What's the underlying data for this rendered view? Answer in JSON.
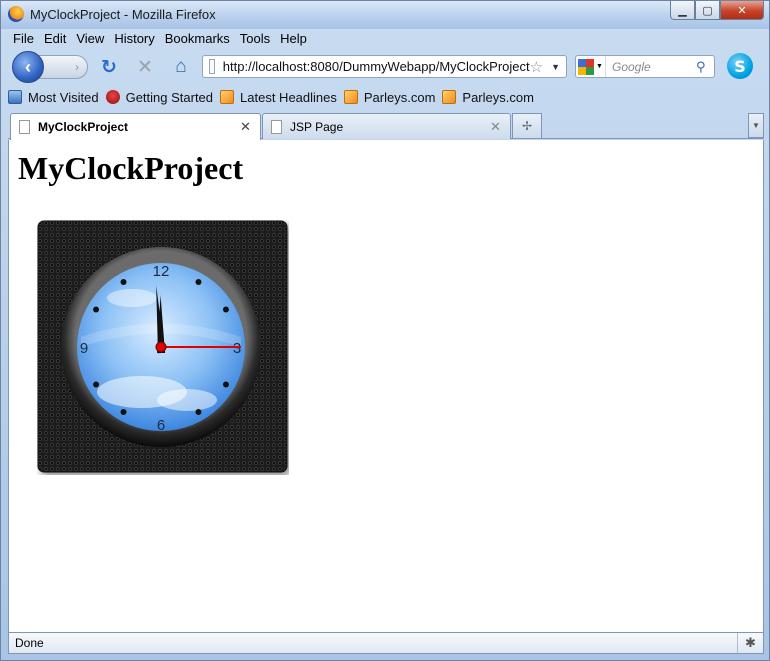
{
  "window": {
    "title": "MyClockProject - Mozilla Firefox",
    "minimize_icon": "minimize-icon",
    "maximize_icon": "maximize-icon",
    "close_icon": "close-icon"
  },
  "menubar": {
    "items": [
      {
        "label": "File",
        "key": "F"
      },
      {
        "label": "Edit",
        "key": "E"
      },
      {
        "label": "View",
        "key": "V"
      },
      {
        "label": "History",
        "key": "s"
      },
      {
        "label": "Bookmarks",
        "key": "B"
      },
      {
        "label": "Tools",
        "key": "T"
      },
      {
        "label": "Help",
        "key": "H"
      }
    ]
  },
  "navbar": {
    "back_glyph": "‹",
    "forward_glyph": "›",
    "reload_glyph": "↻",
    "stop_glyph": "✕",
    "home_glyph": "⌂",
    "url": "http://localhost:8080/DummyWebapp/MyClockProject",
    "search_placeholder": "Google",
    "skype_glyph": "S"
  },
  "bookmarks": {
    "items": [
      {
        "label": "Most Visited",
        "icon": "most-visited-icon"
      },
      {
        "label": "Getting Started",
        "icon": "getting-started-icon"
      },
      {
        "label": "Latest Headlines",
        "icon": "rss-icon"
      },
      {
        "label": "Parleys.com",
        "icon": "rss-icon"
      },
      {
        "label": "Parleys.com",
        "icon": "rss-icon"
      }
    ]
  },
  "tabs": [
    {
      "label": "MyClockProject",
      "active": true
    },
    {
      "label": "JSP Page",
      "active": false
    }
  ],
  "page": {
    "heading": "MyClockProject",
    "clock": {
      "numerals": {
        "top": "12",
        "right": "3",
        "bottom": "6",
        "left": "9"
      },
      "time_shown": {
        "hour": 11,
        "minute": 59,
        "second": 15
      },
      "colors": {
        "face_sky": "#7fb8f2",
        "second_hand": "#e00000",
        "hands": "#111111",
        "frame": "#2a2a2a"
      }
    }
  },
  "statusbar": {
    "text": "Done"
  },
  "colors": {
    "chrome": "#c9dcf1",
    "close_button": "#c6432a"
  }
}
